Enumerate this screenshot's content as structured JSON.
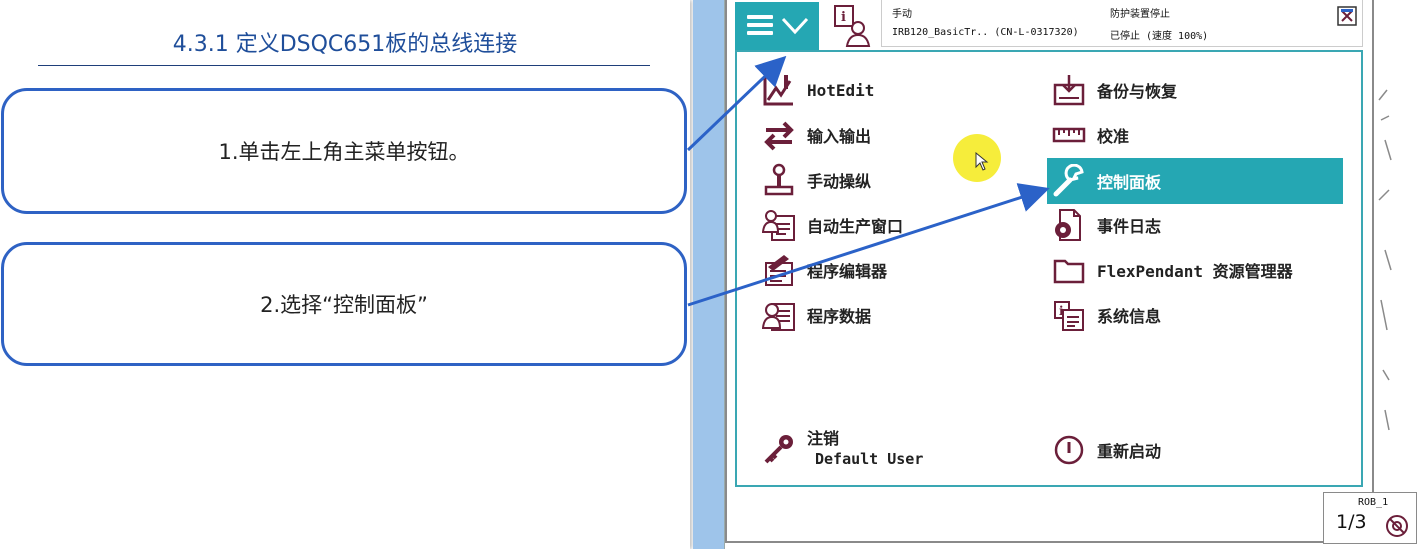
{
  "slide": {
    "title": "4.3.1  定义DSQC651板的总线连接",
    "steps": [
      "1.单击左上角主菜单按钮。",
      "2.选择“控制面板”"
    ]
  },
  "status_bar": {
    "mode": "手动",
    "system": "IRB120_BasicTr..  (CN-L-0317320)",
    "guard_state": "防护装置停止",
    "run_state": "已停止 (速度 100%)"
  },
  "menu": {
    "left": [
      {
        "label": "HotEdit",
        "icon": "hotedit-icon"
      },
      {
        "label": "输入输出",
        "icon": "io-arrows-icon"
      },
      {
        "label": "手动操纵",
        "icon": "joystick-icon"
      },
      {
        "label": "自动生产窗口",
        "icon": "production-window-icon"
      },
      {
        "label": "程序编辑器",
        "icon": "program-editor-icon"
      },
      {
        "label": "程序数据",
        "icon": "program-data-icon"
      }
    ],
    "right": [
      {
        "label": "备份与恢复",
        "icon": "backup-icon"
      },
      {
        "label": "校准",
        "icon": "calibration-icon"
      },
      {
        "label": "控制面板",
        "icon": "wrench-icon",
        "selected": true
      },
      {
        "label": "事件日志",
        "icon": "event-log-icon"
      },
      {
        "label": "FlexPendant 资源管理器",
        "icon": "folder-icon"
      },
      {
        "label": "系统信息",
        "icon": "system-info-icon"
      }
    ],
    "logout": {
      "label": "注销",
      "user": "Default User",
      "icon": "key-icon"
    },
    "restart": {
      "label": "重新启动",
      "icon": "power-icon"
    }
  },
  "robot": {
    "name": "ROB_1",
    "task_fraction": "1/3"
  },
  "colors": {
    "accent": "#25a7b3",
    "icon": "#6b1f3a",
    "arrow": "#2b62c8",
    "title": "#1f4e9a"
  }
}
